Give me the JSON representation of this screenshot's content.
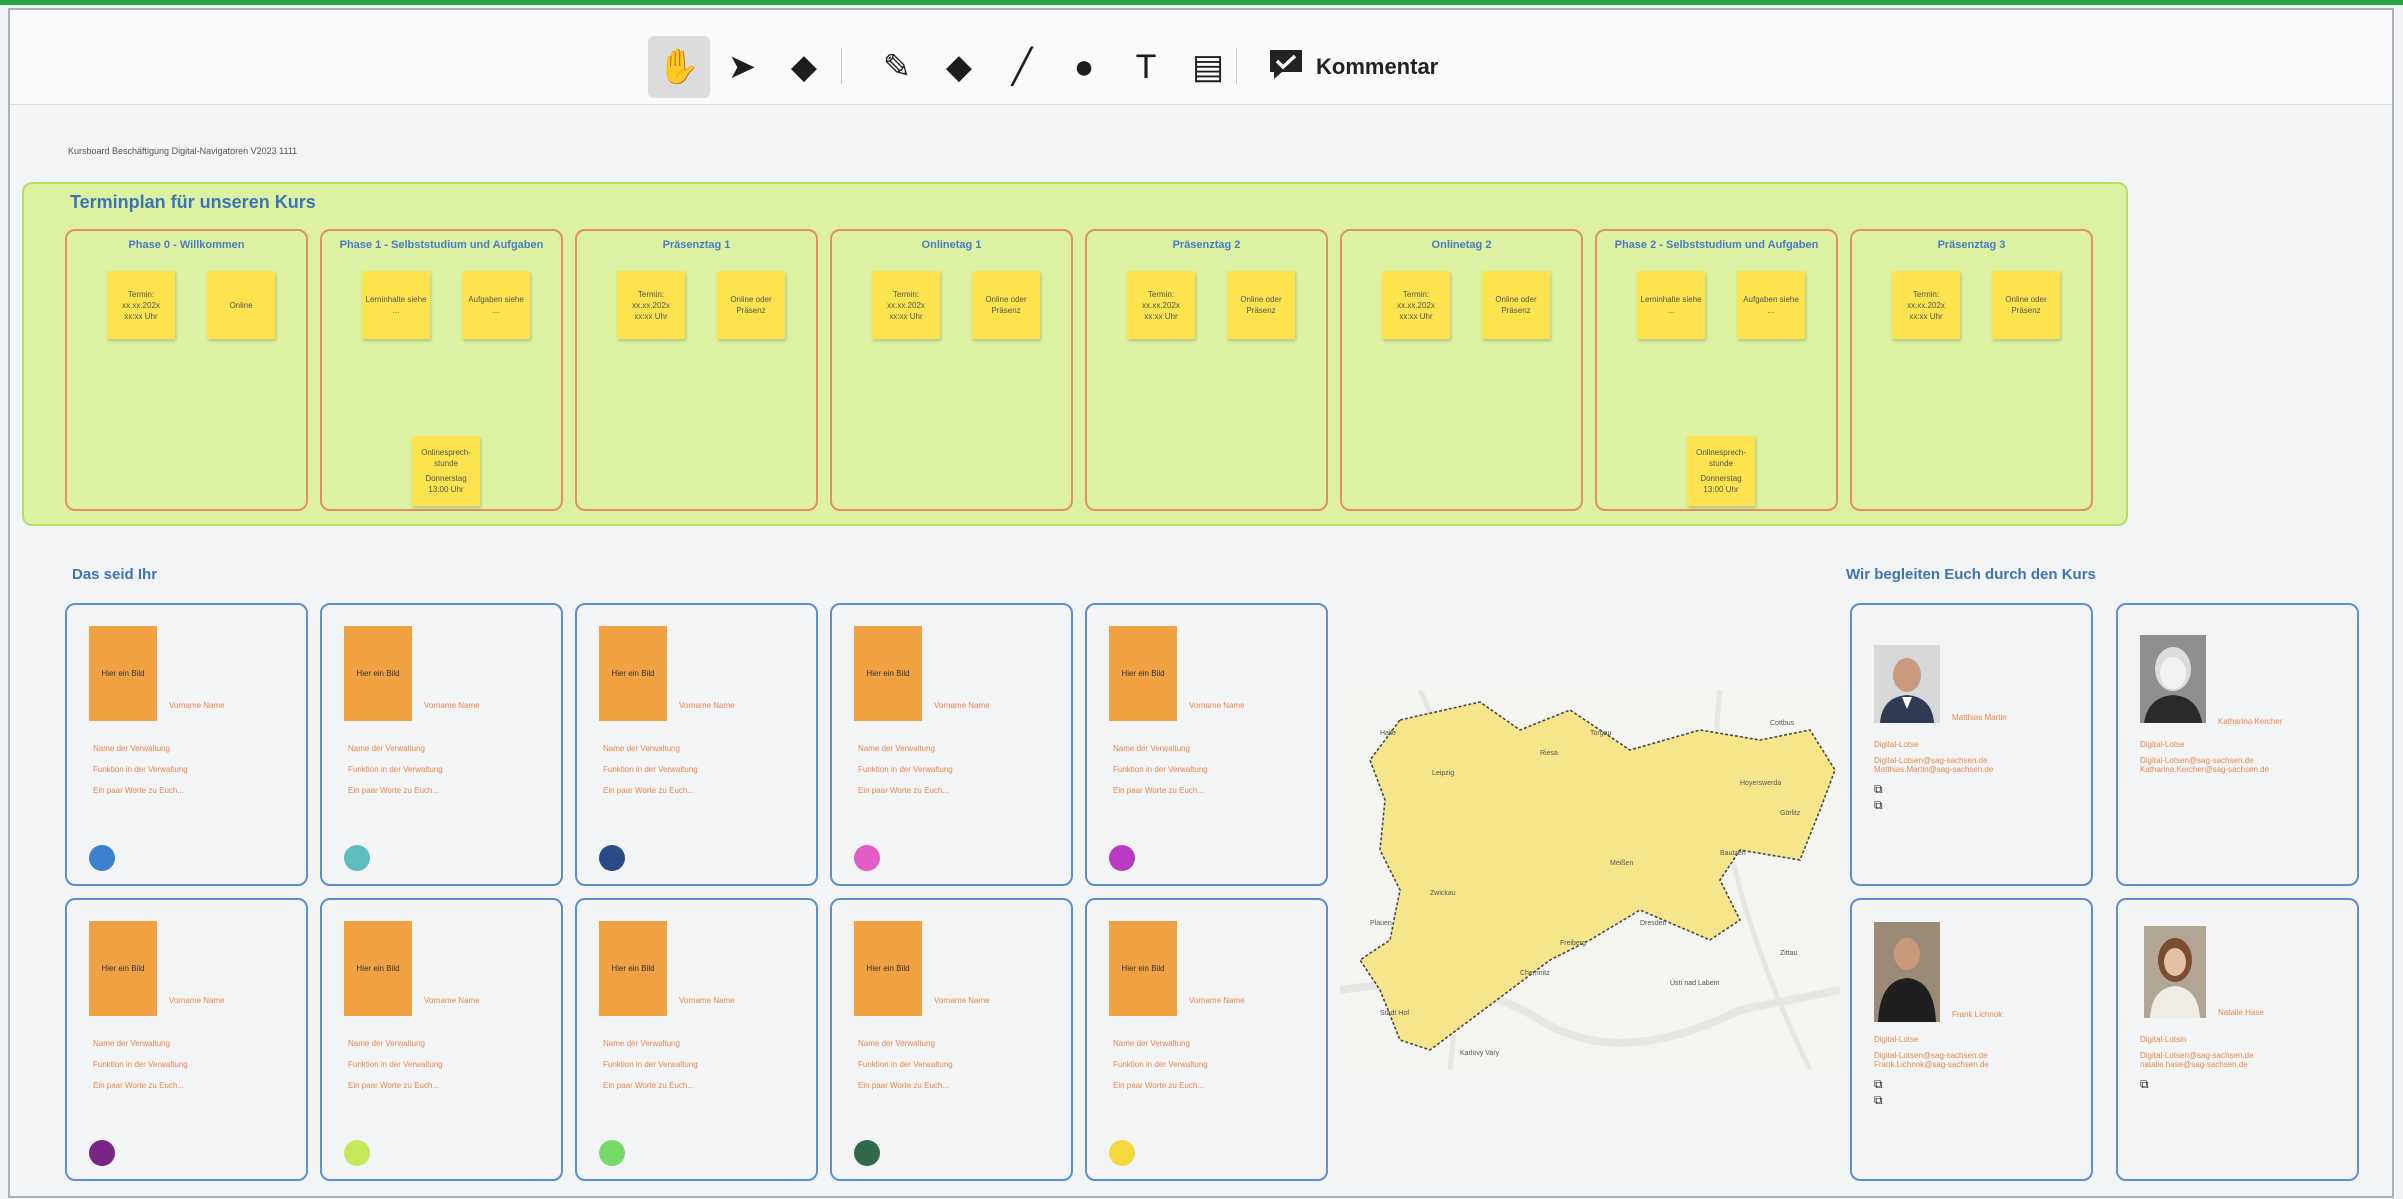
{
  "toolbar": {
    "tools": [
      {
        "id": "hand",
        "icon": "hand-icon",
        "glyph": "✋"
      },
      {
        "id": "select",
        "icon": "cursor-arrow-icon",
        "glyph": "➤"
      },
      {
        "id": "eraser",
        "icon": "eraser-icon",
        "glyph": "◆"
      },
      {
        "id": "pen",
        "icon": "pen-icon",
        "glyph": "✎"
      },
      {
        "id": "marker",
        "icon": "marker-icon",
        "glyph": "◆"
      },
      {
        "id": "line",
        "icon": "line-icon",
        "glyph": "╱"
      },
      {
        "id": "shapes",
        "icon": "shapes-icon",
        "glyph": "●"
      },
      {
        "id": "text",
        "icon": "text-icon",
        "glyph": "T"
      },
      {
        "id": "note",
        "icon": "sticky-note-icon",
        "glyph": "▤"
      }
    ],
    "active_tool": "hand",
    "comment_label": "Kommentar",
    "comment_icon": "comment-check-icon"
  },
  "board": {
    "note": "Kursboard Beschäftigung Digital-Navigatoren V2023 1111"
  },
  "terminplan": {
    "title": "Terminplan für unseren Kurs",
    "phases": [
      {
        "title": "Phase 0 - Willkommen",
        "notes": [
          {
            "lines": [
              "Termin:",
              "xx.xx.202x",
              "xx:xx Uhr"
            ]
          },
          {
            "lines": [
              "Online"
            ]
          }
        ]
      },
      {
        "title": "Phase 1 - Selbststudium und Aufgaben",
        "notes": [
          {
            "lines": [
              "Lerninhalte siehe",
              "..."
            ]
          },
          {
            "lines": [
              "Aufgaben siehe",
              "..."
            ]
          }
        ],
        "extra": {
          "lines": [
            "Onlinesprech-",
            "stunde",
            "",
            "Donnerstag",
            "13:00 Uhr"
          ]
        }
      },
      {
        "title": "Präsenztag 1",
        "notes": [
          {
            "lines": [
              "Termin:",
              "xx.xx.202x",
              "xx:xx Uhr"
            ]
          },
          {
            "lines": [
              "Online oder",
              "Präsenz"
            ]
          }
        ]
      },
      {
        "title": "Onlinetag 1",
        "notes": [
          {
            "lines": [
              "Termin:",
              "xx.xx.202x",
              "xx:xx Uhr"
            ]
          },
          {
            "lines": [
              "Online oder",
              "Präsenz"
            ]
          }
        ]
      },
      {
        "title": "Präsenztag 2",
        "notes": [
          {
            "lines": [
              "Termin:",
              "xx.xx.202x",
              "xx:xx Uhr"
            ]
          },
          {
            "lines": [
              "Online oder",
              "Präsenz"
            ]
          }
        ]
      },
      {
        "title": "Onlinetag 2",
        "notes": [
          {
            "lines": [
              "Termin:",
              "xx.xx.202x",
              "xx:xx Uhr"
            ]
          },
          {
            "lines": [
              "Online oder",
              "Präsenz"
            ]
          }
        ]
      },
      {
        "title": "Phase 2 - Selbststudium und Aufgaben",
        "notes": [
          {
            "lines": [
              "Lerninhalte siehe",
              "..."
            ]
          },
          {
            "lines": [
              "Aufgaben siehe",
              "..."
            ]
          }
        ],
        "extra": {
          "lines": [
            "Onlinesprech-",
            "stunde",
            "",
            "Donnerstag",
            "13:00 Uhr"
          ]
        }
      },
      {
        "title": "Präsenztag 3",
        "notes": [
          {
            "lines": [
              "Termin:",
              "xx.xx.202x",
              "xx:xx Uhr"
            ]
          },
          {
            "lines": [
              "Online oder",
              "Präsenz"
            ]
          }
        ]
      }
    ]
  },
  "participants": {
    "heading": "Das seid Ihr",
    "photo_placeholder": "Hier ein Bild",
    "name_placeholder": "Vorname Name",
    "lines": [
      "Name der Verwaltung",
      "Funktion in der Verwaltung",
      "Ein paar Worte zu Euch..."
    ],
    "dot_colors": [
      "#3d7fd1",
      "#5fbdc2",
      "#274c86",
      "#e35bc4",
      "#b93bc3",
      "#7a2487",
      "#c7e85a",
      "#78d96b",
      "#2f6a4d",
      "#f5d83f"
    ]
  },
  "team": {
    "heading": "Wir begleiten Euch durch den Kurs",
    "members": [
      {
        "name": "Matthias Martin",
        "role": "Digital-Lotse",
        "emails": [
          "Digital-Lotsen@sag-sachsen.de",
          "Matthias.Martin@sag-sachsen.de"
        ],
        "links": 2
      },
      {
        "name": "Katharina Kercher",
        "role": "Digital-Lotse",
        "emails": [
          "Digital-Lotsen@sag-sachsen.de",
          "Katharina.Kercher@sag-sachsen.de"
        ],
        "links": 0
      },
      {
        "name": "Frank Lichnok",
        "role": "Digital-Lotse",
        "emails": [
          "Digital-Lotsen@sag-sachsen.de",
          "Frank.Lichnok@sag-sachsen.de"
        ],
        "links": 2
      },
      {
        "name": "Natalie Hase",
        "role": "Digital-Lotsin",
        "emails": [
          "Digital-Lotsen@sag-sachsen.de",
          "natalie.hase@sag-sachsen.de"
        ],
        "links": 1
      }
    ]
  },
  "map": {
    "places": [
      "Leipzig",
      "Dresden",
      "Chemnitz",
      "Zwickau",
      "Plauen",
      "Görlitz",
      "Bautzen",
      "Riesa",
      "Torgau",
      "Freiberg",
      "Meißen",
      "Hoyerswerda",
      "Stadt Hof",
      "Karlovy Vary",
      "Halle",
      "Ústí nad Labem",
      "Zittau",
      "Cottbus"
    ]
  }
}
